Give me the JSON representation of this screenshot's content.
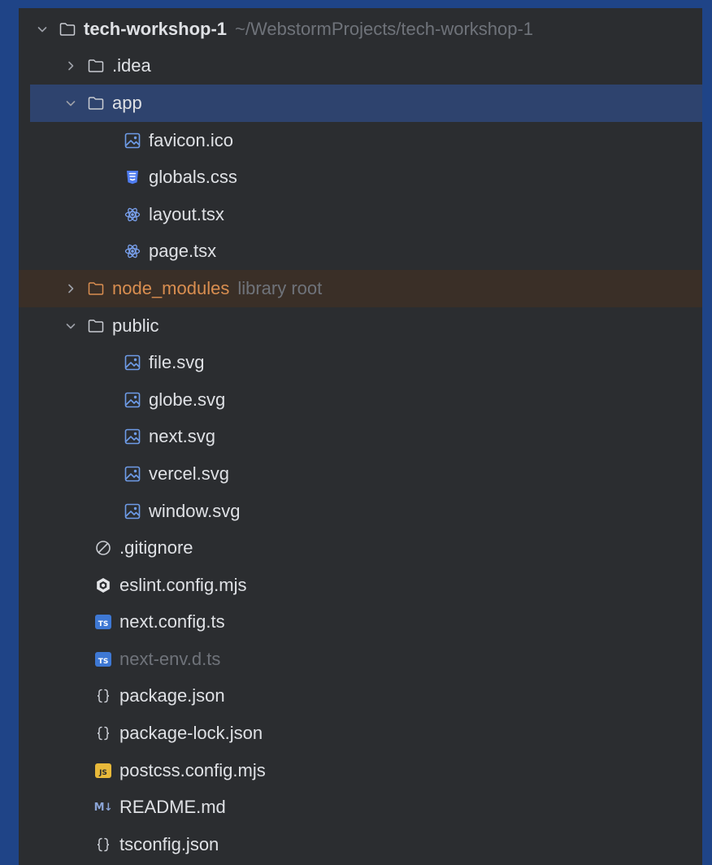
{
  "project": {
    "name": "tech-workshop-1",
    "path": "~/WebstormProjects/tech-workshop-1"
  },
  "tree": {
    "idea": ".idea",
    "app": {
      "label": "app",
      "files": [
        "favicon.ico",
        "globals.css",
        "layout.tsx",
        "page.tsx"
      ]
    },
    "node_modules": {
      "label": "node_modules",
      "hint": "library root"
    },
    "public": {
      "label": "public",
      "files": [
        "file.svg",
        "globe.svg",
        "next.svg",
        "vercel.svg",
        "window.svg"
      ]
    },
    "root_files": [
      ".gitignore",
      "eslint.config.mjs",
      "next.config.ts",
      "next-env.d.ts",
      "package.json",
      "package-lock.json",
      "postcss.config.mjs",
      "README.md",
      "tsconfig.json"
    ]
  },
  "badges": {
    "ts": "TS",
    "js": "JS",
    "md": "M↓"
  },
  "colors": {
    "background": "#1f4487",
    "panel": "#2b2d30",
    "selected_row": "#2e436e",
    "library_row": "#3a2f27",
    "text": "#dfe1e5",
    "hint": "#6f737a",
    "excluded": "#d98e50",
    "image_icon": "#6e9ce8",
    "css_icon": "#4f7cf0",
    "react_icon": "#7aa2f0"
  },
  "icons": {
    "folder": "folder-icon",
    "image": "image-file-icon",
    "css": "css-file-icon",
    "react": "react-icon",
    "ignore": "ignore-file-icon",
    "eslint": "eslint-icon",
    "json": "json-braces-icon"
  }
}
